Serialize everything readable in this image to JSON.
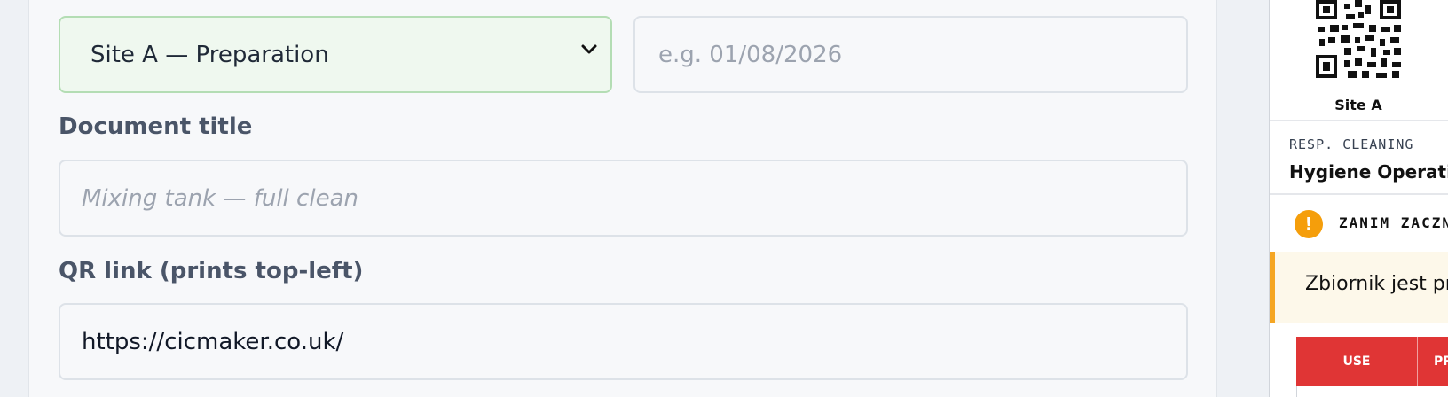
{
  "form": {
    "site_select": {
      "value": "Site A — Preparation"
    },
    "date_input": {
      "placeholder": "e.g. 01/08/2026"
    },
    "doc_title": {
      "label": "Document title",
      "placeholder": "Mixing tank — full clean"
    },
    "qr_link": {
      "label": "QR link (prints top-left)",
      "value": "https://cicmaker.co.uk/"
    }
  },
  "preview": {
    "qr_caption": "Site A",
    "resp_label": "RESP. CLEANING",
    "resp_value": "Hygiene Operative",
    "warning_heading": "ZANIM ZACZNI",
    "note_text": "Zbiornik jest prz",
    "table_headers": [
      "USE",
      "PR"
    ]
  },
  "colors": {
    "accent_green": "#b4ddb4",
    "warning_orange": "#f59e0b",
    "table_red": "#e03535"
  },
  "icons": {
    "select_chevron": "chevron-down-icon",
    "qr_code": "qr-code-icon",
    "warning": "exclamation-icon"
  }
}
